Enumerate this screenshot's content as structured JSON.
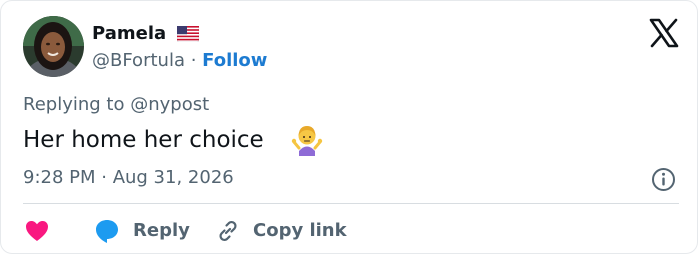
{
  "author": {
    "name": "Pamela",
    "handle": "@BFortula",
    "separator": " · ",
    "follow_label": "Follow",
    "flag_icon": "us-flag-icon",
    "avatar_icon": "user-avatar"
  },
  "header": {
    "logo_icon": "x-logo-icon"
  },
  "tweet": {
    "reply_prefix": "Replying to ",
    "reply_to": "@nypost",
    "text": "Her home her choice",
    "emoji_icon": "person-shrugging-icon",
    "timestamp": "9:28 PM · Aug 31, 2026"
  },
  "actions": {
    "like_icon": "heart-icon",
    "reply_label": "Reply",
    "reply_icon": "speech-bubble-icon",
    "copy_label": "Copy link",
    "copy_icon": "link-icon",
    "info_icon": "info-icon"
  },
  "colors": {
    "link": "#1d7bd1",
    "heart": "#f91880",
    "reply_bubble": "#1d9bf0",
    "secondary_text": "#536471",
    "primary_text": "#0f1419"
  }
}
